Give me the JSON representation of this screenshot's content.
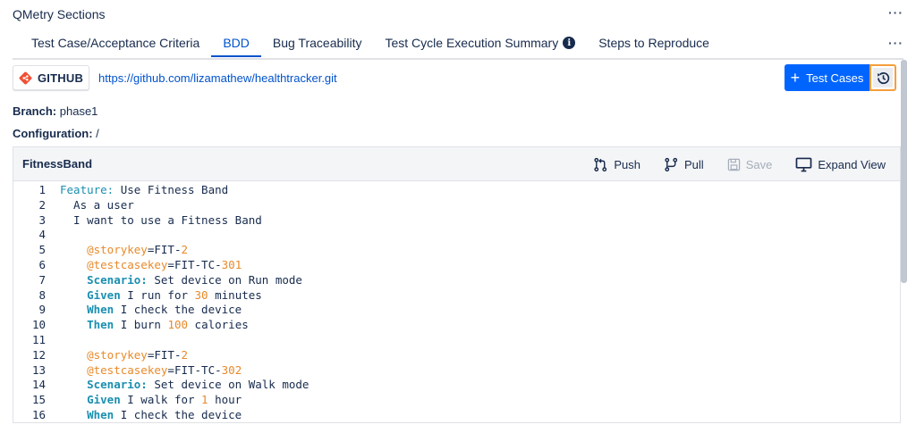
{
  "section": {
    "title": "QMetry Sections"
  },
  "tabs": [
    {
      "label": "Test Case/Acceptance Criteria",
      "active": false
    },
    {
      "label": "BDD",
      "active": true
    },
    {
      "label": "Bug Traceability",
      "active": false
    },
    {
      "label": "Test Cycle Execution Summary",
      "active": false,
      "info_icon": "info-icon"
    },
    {
      "label": "Steps to Reproduce",
      "active": false
    }
  ],
  "repo": {
    "provider_label": "GITHUB",
    "provider_icon": "git-diamond-icon",
    "url": "https://github.com/lizamathew/healthtracker.git"
  },
  "buttons": {
    "test_cases_label": "Test Cases",
    "history_icon": "history-icon"
  },
  "meta": {
    "branch_key": "Branch:",
    "branch_value": "phase1",
    "config_key": "Configuration:",
    "config_value": "/"
  },
  "editor": {
    "file_name": "FitnessBand",
    "actions": {
      "push": "Push",
      "pull": "Pull",
      "save": "Save",
      "expand": "Expand View"
    },
    "lines": [
      {
        "n": "1",
        "segments": [
          {
            "t": "Feature:",
            "c": "kwn"
          },
          {
            "t": " Use Fitness Band",
            "c": ""
          }
        ]
      },
      {
        "n": "2",
        "segments": [
          {
            "t": "  As a user",
            "c": ""
          }
        ]
      },
      {
        "n": "3",
        "segments": [
          {
            "t": "  I want to use a Fitness Band",
            "c": ""
          }
        ]
      },
      {
        "n": "4",
        "segments": [
          {
            "t": "",
            "c": ""
          }
        ]
      },
      {
        "n": "5",
        "segments": [
          {
            "t": "    @storykey",
            "c": "tag"
          },
          {
            "t": "=FIT-",
            "c": ""
          },
          {
            "t": "2",
            "c": "num"
          }
        ]
      },
      {
        "n": "6",
        "segments": [
          {
            "t": "    @testcasekey",
            "c": "tag"
          },
          {
            "t": "=FIT-TC-",
            "c": ""
          },
          {
            "t": "301",
            "c": "num"
          }
        ]
      },
      {
        "n": "7",
        "segments": [
          {
            "t": "    Scenario:",
            "c": "kw"
          },
          {
            "t": " Set device on Run mode",
            "c": ""
          }
        ]
      },
      {
        "n": "8",
        "segments": [
          {
            "t": "    Given",
            "c": "kw"
          },
          {
            "t": " I run for ",
            "c": ""
          },
          {
            "t": "30",
            "c": "num"
          },
          {
            "t": " minutes",
            "c": ""
          }
        ]
      },
      {
        "n": "9",
        "segments": [
          {
            "t": "    When",
            "c": "kw"
          },
          {
            "t": " I check the device",
            "c": ""
          }
        ]
      },
      {
        "n": "10",
        "segments": [
          {
            "t": "    Then",
            "c": "kw"
          },
          {
            "t": " I burn ",
            "c": ""
          },
          {
            "t": "100",
            "c": "num"
          },
          {
            "t": " calories",
            "c": ""
          }
        ]
      },
      {
        "n": "11",
        "segments": [
          {
            "t": "",
            "c": ""
          }
        ]
      },
      {
        "n": "12",
        "segments": [
          {
            "t": "    @storykey",
            "c": "tag"
          },
          {
            "t": "=FIT-",
            "c": ""
          },
          {
            "t": "2",
            "c": "num"
          }
        ]
      },
      {
        "n": "13",
        "segments": [
          {
            "t": "    @testcasekey",
            "c": "tag"
          },
          {
            "t": "=FIT-TC-",
            "c": ""
          },
          {
            "t": "302",
            "c": "num"
          }
        ]
      },
      {
        "n": "14",
        "segments": [
          {
            "t": "    Scenario:",
            "c": "kw"
          },
          {
            "t": " Set device on Walk mode",
            "c": ""
          }
        ]
      },
      {
        "n": "15",
        "segments": [
          {
            "t": "    Given",
            "c": "kw"
          },
          {
            "t": " I walk for ",
            "c": ""
          },
          {
            "t": "1",
            "c": "num"
          },
          {
            "t": " hour",
            "c": ""
          }
        ]
      },
      {
        "n": "16",
        "segments": [
          {
            "t": "    When",
            "c": "kw"
          },
          {
            "t": " I check the device",
            "c": ""
          }
        ]
      }
    ]
  },
  "colors": {
    "accent": "#0052cc",
    "primary_button": "#0065ff",
    "focus_ring": "#f59e3b",
    "keyword": "#1a8fb0",
    "tag": "#e88a2a",
    "git_brand": "#f05133"
  }
}
